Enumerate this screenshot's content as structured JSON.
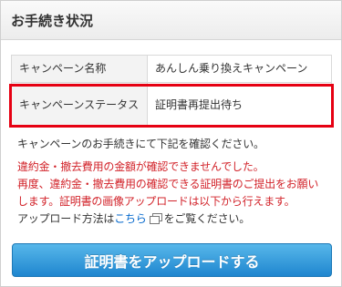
{
  "header": {
    "title": "お手続き状況"
  },
  "table": {
    "rows": [
      {
        "label": "キャンペーン名称",
        "value": "あんしん乗り換えキャンペーン"
      },
      {
        "label": "キャンペーンステータス",
        "value": "証明書再提出待ち"
      }
    ]
  },
  "messages": {
    "intro": "キャンペーンのお手続きにて下記を確認ください。",
    "warning_lines": [
      "違約金・撤去費用の金額が確認できませんでした。",
      "再度、違約金・撤去費用の確認できる証明書のご提出をお願い",
      "します。証明書の画像アップロードは以下から行えます。"
    ],
    "upload_prefix": "アップロード方法は",
    "upload_link": "こちら",
    "upload_suffix": "をご覧ください。"
  },
  "button": {
    "label": "証明書をアップロードする"
  },
  "colors": {
    "status_red": "#d2232a",
    "highlight_red": "#e60012",
    "button_blue": "#1f86cf",
    "link_blue": "#0066cc"
  },
  "icons": {
    "external_window": "external-window-icon"
  }
}
